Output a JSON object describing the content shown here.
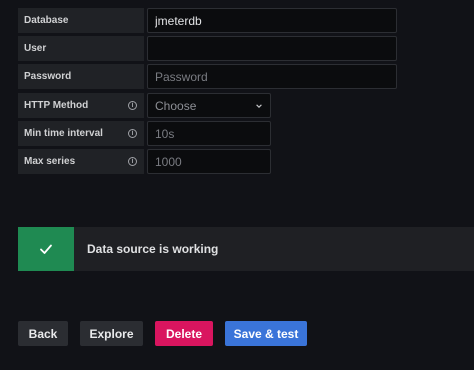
{
  "form": {
    "database": {
      "label": "Database",
      "value": "jmeterdb",
      "placeholder": ""
    },
    "user": {
      "label": "User",
      "value": "",
      "placeholder": ""
    },
    "password": {
      "label": "Password",
      "value": "",
      "placeholder": "Password"
    },
    "http_method": {
      "label": "HTTP Method",
      "value": "Choose",
      "icon": "info-icon"
    },
    "min_time_interval": {
      "label": "Min time interval",
      "value": "",
      "placeholder": "10s",
      "icon": "info-icon"
    },
    "max_series": {
      "label": "Max series",
      "value": "",
      "placeholder": "1000",
      "icon": "info-icon"
    }
  },
  "status": {
    "message": "Data source is working",
    "icon": "check-icon",
    "color": "#1f8a52"
  },
  "actions": {
    "back_label": "Back",
    "explore_label": "Explore",
    "delete_label": "Delete",
    "save_label": "Save & test",
    "delete_color": "#d9155f",
    "save_color": "#3a74d9"
  }
}
